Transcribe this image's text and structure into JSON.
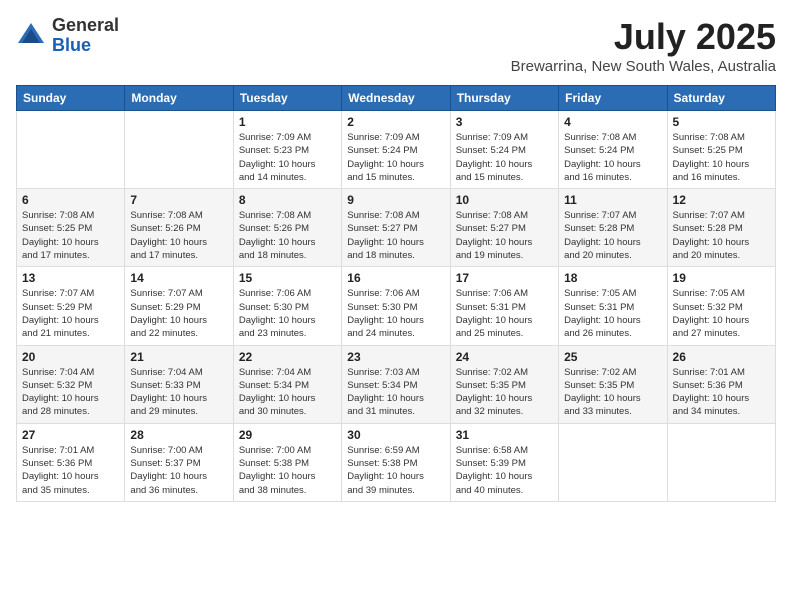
{
  "header": {
    "logo_general": "General",
    "logo_blue": "Blue",
    "month_year": "July 2025",
    "location": "Brewarrina, New South Wales, Australia"
  },
  "weekdays": [
    "Sunday",
    "Monday",
    "Tuesday",
    "Wednesday",
    "Thursday",
    "Friday",
    "Saturday"
  ],
  "weeks": [
    [
      {
        "num": "",
        "info": ""
      },
      {
        "num": "",
        "info": ""
      },
      {
        "num": "1",
        "info": "Sunrise: 7:09 AM\nSunset: 5:23 PM\nDaylight: 10 hours\nand 14 minutes."
      },
      {
        "num": "2",
        "info": "Sunrise: 7:09 AM\nSunset: 5:24 PM\nDaylight: 10 hours\nand 15 minutes."
      },
      {
        "num": "3",
        "info": "Sunrise: 7:09 AM\nSunset: 5:24 PM\nDaylight: 10 hours\nand 15 minutes."
      },
      {
        "num": "4",
        "info": "Sunrise: 7:08 AM\nSunset: 5:24 PM\nDaylight: 10 hours\nand 16 minutes."
      },
      {
        "num": "5",
        "info": "Sunrise: 7:08 AM\nSunset: 5:25 PM\nDaylight: 10 hours\nand 16 minutes."
      }
    ],
    [
      {
        "num": "6",
        "info": "Sunrise: 7:08 AM\nSunset: 5:25 PM\nDaylight: 10 hours\nand 17 minutes."
      },
      {
        "num": "7",
        "info": "Sunrise: 7:08 AM\nSunset: 5:26 PM\nDaylight: 10 hours\nand 17 minutes."
      },
      {
        "num": "8",
        "info": "Sunrise: 7:08 AM\nSunset: 5:26 PM\nDaylight: 10 hours\nand 18 minutes."
      },
      {
        "num": "9",
        "info": "Sunrise: 7:08 AM\nSunset: 5:27 PM\nDaylight: 10 hours\nand 18 minutes."
      },
      {
        "num": "10",
        "info": "Sunrise: 7:08 AM\nSunset: 5:27 PM\nDaylight: 10 hours\nand 19 minutes."
      },
      {
        "num": "11",
        "info": "Sunrise: 7:07 AM\nSunset: 5:28 PM\nDaylight: 10 hours\nand 20 minutes."
      },
      {
        "num": "12",
        "info": "Sunrise: 7:07 AM\nSunset: 5:28 PM\nDaylight: 10 hours\nand 20 minutes."
      }
    ],
    [
      {
        "num": "13",
        "info": "Sunrise: 7:07 AM\nSunset: 5:29 PM\nDaylight: 10 hours\nand 21 minutes."
      },
      {
        "num": "14",
        "info": "Sunrise: 7:07 AM\nSunset: 5:29 PM\nDaylight: 10 hours\nand 22 minutes."
      },
      {
        "num": "15",
        "info": "Sunrise: 7:06 AM\nSunset: 5:30 PM\nDaylight: 10 hours\nand 23 minutes."
      },
      {
        "num": "16",
        "info": "Sunrise: 7:06 AM\nSunset: 5:30 PM\nDaylight: 10 hours\nand 24 minutes."
      },
      {
        "num": "17",
        "info": "Sunrise: 7:06 AM\nSunset: 5:31 PM\nDaylight: 10 hours\nand 25 minutes."
      },
      {
        "num": "18",
        "info": "Sunrise: 7:05 AM\nSunset: 5:31 PM\nDaylight: 10 hours\nand 26 minutes."
      },
      {
        "num": "19",
        "info": "Sunrise: 7:05 AM\nSunset: 5:32 PM\nDaylight: 10 hours\nand 27 minutes."
      }
    ],
    [
      {
        "num": "20",
        "info": "Sunrise: 7:04 AM\nSunset: 5:32 PM\nDaylight: 10 hours\nand 28 minutes."
      },
      {
        "num": "21",
        "info": "Sunrise: 7:04 AM\nSunset: 5:33 PM\nDaylight: 10 hours\nand 29 minutes."
      },
      {
        "num": "22",
        "info": "Sunrise: 7:04 AM\nSunset: 5:34 PM\nDaylight: 10 hours\nand 30 minutes."
      },
      {
        "num": "23",
        "info": "Sunrise: 7:03 AM\nSunset: 5:34 PM\nDaylight: 10 hours\nand 31 minutes."
      },
      {
        "num": "24",
        "info": "Sunrise: 7:02 AM\nSunset: 5:35 PM\nDaylight: 10 hours\nand 32 minutes."
      },
      {
        "num": "25",
        "info": "Sunrise: 7:02 AM\nSunset: 5:35 PM\nDaylight: 10 hours\nand 33 minutes."
      },
      {
        "num": "26",
        "info": "Sunrise: 7:01 AM\nSunset: 5:36 PM\nDaylight: 10 hours\nand 34 minutes."
      }
    ],
    [
      {
        "num": "27",
        "info": "Sunrise: 7:01 AM\nSunset: 5:36 PM\nDaylight: 10 hours\nand 35 minutes."
      },
      {
        "num": "28",
        "info": "Sunrise: 7:00 AM\nSunset: 5:37 PM\nDaylight: 10 hours\nand 36 minutes."
      },
      {
        "num": "29",
        "info": "Sunrise: 7:00 AM\nSunset: 5:38 PM\nDaylight: 10 hours\nand 38 minutes."
      },
      {
        "num": "30",
        "info": "Sunrise: 6:59 AM\nSunset: 5:38 PM\nDaylight: 10 hours\nand 39 minutes."
      },
      {
        "num": "31",
        "info": "Sunrise: 6:58 AM\nSunset: 5:39 PM\nDaylight: 10 hours\nand 40 minutes."
      },
      {
        "num": "",
        "info": ""
      },
      {
        "num": "",
        "info": ""
      }
    ]
  ]
}
